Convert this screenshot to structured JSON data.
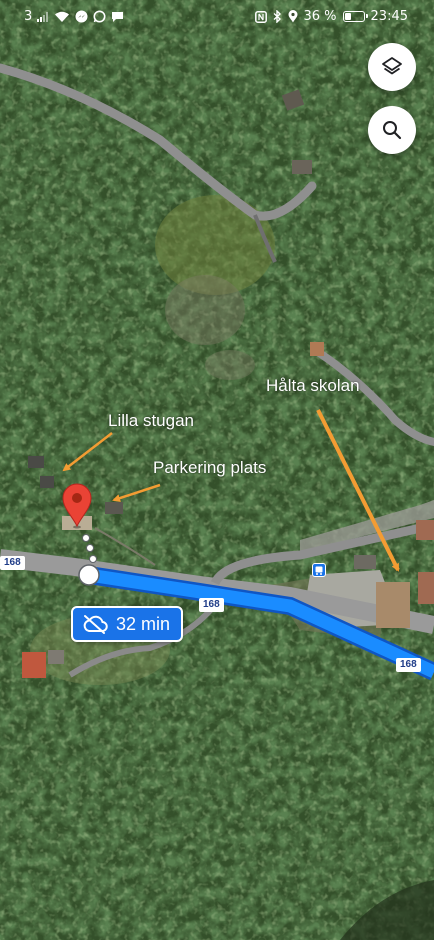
{
  "status_bar": {
    "network": "3",
    "battery_percent": "36 %",
    "battery_level": 0.36,
    "time": "23:45",
    "icons": [
      "signal-icon",
      "wifi-icon",
      "messenger-icon",
      "whatsapp-icon",
      "chat-icon",
      "nfc-icon",
      "bluetooth-icon",
      "location-icon",
      "battery-icon"
    ]
  },
  "map": {
    "type": "satellite",
    "icons": [
      "layers-icon",
      "search-icon",
      "destination-pin-icon",
      "bus-stop-icon",
      "cloud-off-icon"
    ],
    "route_numbers": [
      "168",
      "168",
      "168"
    ],
    "eta": {
      "label": "32 min",
      "icon": "cloud-off-icon"
    },
    "annotations": {
      "lilla_stugan": "Lilla stugan",
      "parkering_plats": "Parkering plats",
      "halta_skolan": "Hålta skolan"
    },
    "colors": {
      "route": "#1a73e8",
      "annotation_arrow": "#f39c33",
      "pin": "#ea4335",
      "road": "#8f8f8f"
    }
  }
}
